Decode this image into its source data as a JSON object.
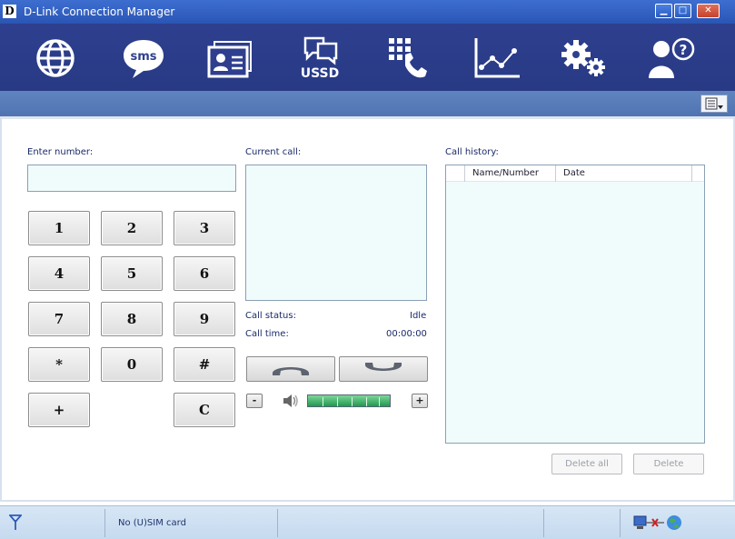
{
  "window": {
    "logo_letter": "D",
    "title": "D-Link Connection Manager",
    "minimize_glyph": "▁",
    "maximize_glyph": "□",
    "close_glyph": "✕"
  },
  "toolbar": {
    "items": [
      {
        "icon": "globe-icon",
        "label": ""
      },
      {
        "icon": "sms-icon",
        "label": "sms"
      },
      {
        "icon": "contacts-icon",
        "label": ""
      },
      {
        "icon": "ussd-icon",
        "label": "USSD"
      },
      {
        "icon": "phone-dialpad-icon",
        "label": ""
      },
      {
        "icon": "statistics-chart-icon",
        "label": ""
      },
      {
        "icon": "settings-gears-icon",
        "label": ""
      },
      {
        "icon": "help-user-icon",
        "label": "?"
      }
    ]
  },
  "dialer": {
    "enter_number_label": "Enter number:",
    "number_value": "",
    "keys": [
      "1",
      "2",
      "3",
      "4",
      "5",
      "6",
      "7",
      "8",
      "9",
      "*",
      "0",
      "#",
      "+",
      "C"
    ]
  },
  "current_call": {
    "label": "Current call:",
    "status_label": "Call status:",
    "status_value": "Idle",
    "time_label": "Call time:",
    "time_value": "00:00:00",
    "volume_minus": "-",
    "volume_plus": "+"
  },
  "call_history": {
    "label": "Call history:",
    "columns": [
      "Name/Number",
      "Date"
    ],
    "rows": [],
    "delete_all_label": "Delete all",
    "delete_label": "Delete"
  },
  "statusbar": {
    "sim_status": "No (U)SIM card"
  },
  "colors": {
    "toolbar_bg": "#2e3f8f",
    "subbar_bg": "#5f84bf",
    "field_bg": "#f0fbfb",
    "volume_green": "#1f9a4d"
  }
}
